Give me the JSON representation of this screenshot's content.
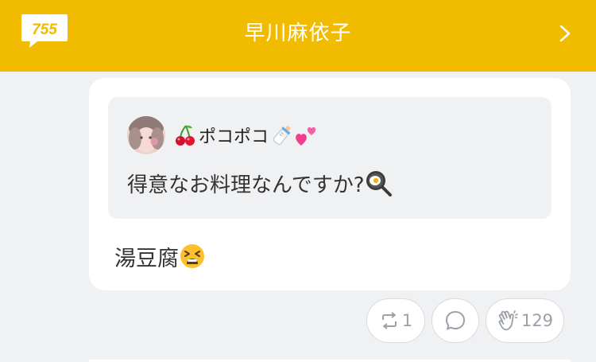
{
  "header": {
    "logo_text": "755",
    "title": "早川麻依子",
    "chevron_icon": "chevron-right-icon",
    "background_color": "#f1bc00"
  },
  "quote": {
    "user_prefix_emoji": "cherry-emoji",
    "user_name": "ポコポコ",
    "user_suffix_emojis": [
      "baby-bottle-emoji",
      "two-hearts-emoji"
    ],
    "text": "得意なお料理なんですか?",
    "text_emoji": "frying-pan-egg-emoji"
  },
  "post": {
    "text": "湯豆腐",
    "text_emoji": "tired-face-emoji"
  },
  "actions": {
    "retweet_count": "1",
    "comment_count": "",
    "clap_count": "129"
  }
}
